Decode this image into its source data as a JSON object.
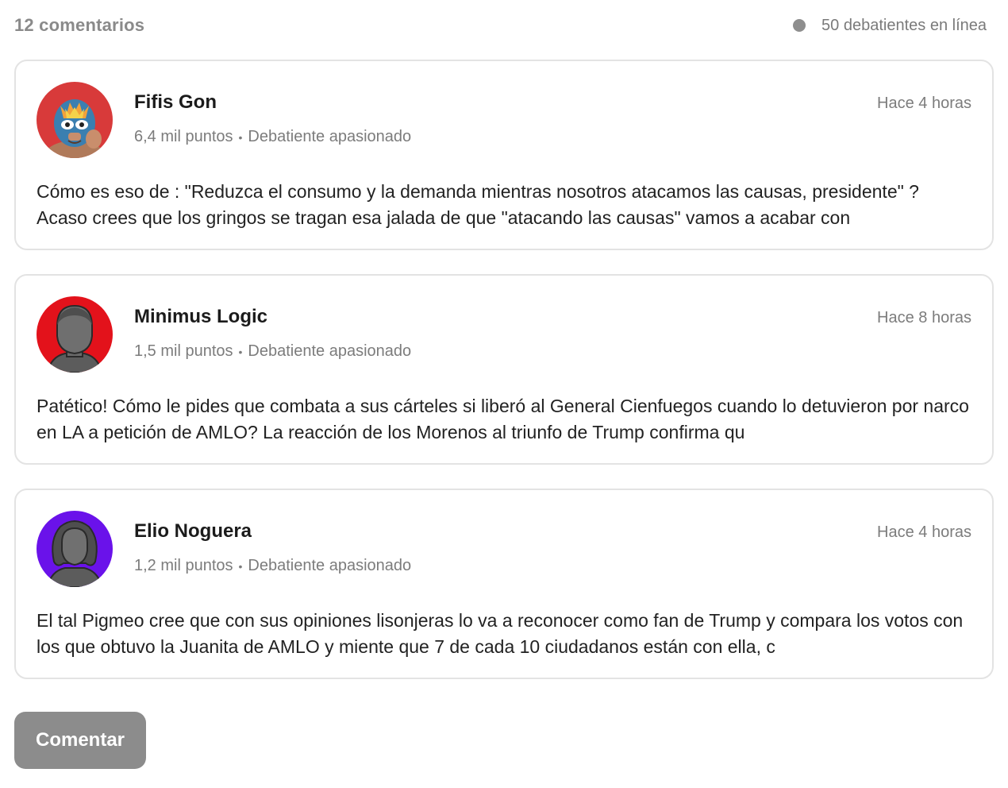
{
  "header": {
    "comment_count": "12 comentarios",
    "online_text": "50 debatientes en línea"
  },
  "comments": [
    {
      "name": "Fifis Gon",
      "points": "6,4 mil puntos",
      "rank": "Debatiente apasionado",
      "time": "Hace 4 horas",
      "text": "Cómo es eso de : \"Reduzca el consumo y la demanda mientras nosotros atacamos las causas, presidente\" ? Acaso crees que los gringos se tragan esa jalada de que \"atacando las causas\" vamos a acabar con",
      "avatar_icon": "luchador-mask-avatar-icon",
      "avatar_color": "#d83a3a"
    },
    {
      "name": "Minimus Logic",
      "points": "1,5 mil puntos",
      "rank": "Debatiente apasionado",
      "time": "Hace 8 horas",
      "text": "Patético! Cómo le pides que combata a sus cárteles si liberó al General Cienfuegos cuando lo detuvieron por narco en LA a petición de AMLO? La reacción de los Morenos al triunfo de Trump confirma qu",
      "avatar_icon": "male-silhouette-avatar-icon",
      "avatar_color": "#e3121b"
    },
    {
      "name": "Elio Noguera",
      "points": "1,2 mil puntos",
      "rank": "Debatiente apasionado",
      "time": "Hace 4 horas",
      "text": "El tal Pigmeo cree que con sus opiniones lisonjeras lo va a reconocer como fan de Trump y compara los votos con los que obtuvo la Juanita de AMLO y miente que 7 de cada 10 ciudadanos están con ella, c",
      "avatar_icon": "female-silhouette-avatar-icon",
      "avatar_color": "#6a12ea"
    }
  ],
  "actions": {
    "comment_button": "Comentar"
  },
  "colors": {
    "button_bg": "#8c8c8c",
    "online_dot": "#8e8e8e",
    "card_border": "#e3e3e3"
  }
}
